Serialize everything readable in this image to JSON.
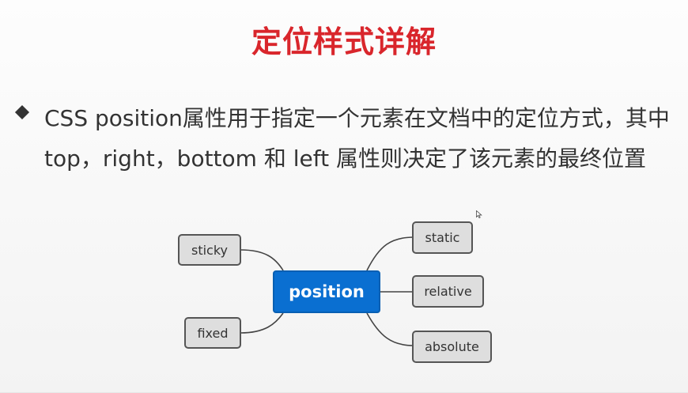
{
  "slide": {
    "title": "定位样式详解",
    "bullet": "CSS position属性用于指定一个元素在文档中的定位方式，其中top，right，bottom 和 left 属性则决定了该元素的最终位置"
  },
  "mindmap": {
    "center": "position",
    "left_nodes": [
      "sticky",
      "fixed"
    ],
    "right_nodes": [
      "static",
      "relative",
      "absolute"
    ]
  },
  "colors": {
    "title": "#d9262c",
    "center_node": "#0a6fd1",
    "node_fill": "#dedede",
    "node_border": "#555555"
  }
}
